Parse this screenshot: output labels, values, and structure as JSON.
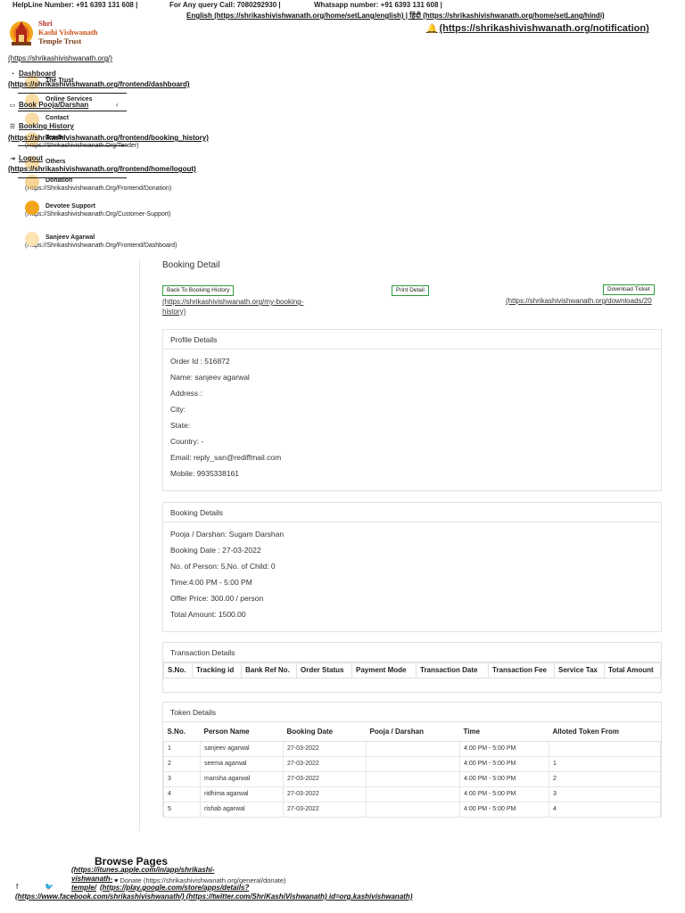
{
  "topbar": {
    "helpline": "HelpLine Number: +91 6393 131 608 |",
    "query": "For Any query Call: 7080292930 |",
    "whatsapp": "Whatsapp number: +91 6393 131 608 |",
    "lang_links": "English (https://shrikashivishwanath.org/home/setLang/english) | हिंदी (https://shrikashivishwanath.org/home/setLang/hindi)",
    "notification": "(https://shrikashivishwanath.org/notification)"
  },
  "logo": {
    "line1": "Shri",
    "line2": "Kashi Vishwanath",
    "line3": "Temple Trust",
    "url": "(https://shrikashivishwanath.org/)"
  },
  "nav": {
    "dashboard": "Dashboard",
    "dashboard_url": "(https://shrikashivishwanath.org/frontend/dashboard)",
    "book_pooja": "Book Pooja/Darshan",
    "booking_history": "Booking History",
    "booking_history_url": "(https://shrikashivishwanath.org/frontend/booking_history)",
    "logout": "Logout",
    "logout_url": "(https://shrikashivishwanath.org/frontend/home/logout)"
  },
  "nav2": {
    "trust": "The Trust",
    "online_services": "Online Services",
    "contact": "Contact",
    "tender": "Tender",
    "tender_url": "(Https://Shrikashivishwanath.Org/Tender)",
    "others": "Others",
    "donation": "Donation",
    "donation_url": "(Https://Shrikashivishwanath.Org/Frontend/Donation)",
    "devotee_support": "Devotee Support",
    "devotee_support_url": "(Https://Shrikashivishwanath.Org/Customer-Support)",
    "user": "Sanjeev Agarwal",
    "user_url": "(Https://Shrikashivishwanath.Org/Frontend/Dashboard)"
  },
  "page": {
    "title": "Booking Detail",
    "back_btn": "Back To Booking History",
    "back_url": "(https://shrikashivishwanath.org/my-booking-history)",
    "print_btn": "Print Detail",
    "download_btn": "Download Ticket",
    "download_url": "(https://shrikashivishwanath.org/downloads/20"
  },
  "profile": {
    "heading": "Profile Details",
    "rows": [
      "Order Id : 516872",
      "Name: sanjeev agarwal",
      "Address :",
      "City:",
      "State:",
      "Country: -",
      "Email: reply_san@rediffmail.com",
      "Mobile: 9935338161"
    ]
  },
  "booking": {
    "heading": "Booking Details",
    "rows": [
      "Pooja / Darshan: Sugam Darshan",
      "Booking Date : 27-03-2022",
      "No. of Person: 5,No. of Child: 0",
      "Time:4:00 PM - 5:00 PM",
      "Offer Price: 300.00 / person",
      "Total Amount: 1500.00"
    ]
  },
  "transaction": {
    "heading": "Transaction Details",
    "columns": [
      "S.No.",
      "Tracking id",
      "Bank Ref No.",
      "Order Status",
      "Payment Mode",
      "Transaction Date",
      "Transaction Fee",
      "Service Tax",
      "Total Amount"
    ]
  },
  "token": {
    "heading": "Token Details",
    "columns": [
      "S.No.",
      "Person Name",
      "Booking Date",
      "Pooja / Darshan",
      "Time",
      "Alloted Token From"
    ],
    "rows": [
      [
        "1",
        "sanjeev agarwal",
        "27-03-2022",
        "",
        "4:00 PM - 5:00 PM",
        ""
      ],
      [
        "2",
        "seema agarwal",
        "27-03-2022",
        "",
        "4:00 PM - 5:00 PM",
        "1"
      ],
      [
        "3",
        "mansha agarwal",
        "27-03-2022",
        "",
        "4:00 PM - 5:00 PM",
        "2"
      ],
      [
        "4",
        "ridhima agarwal",
        "27-03-2022",
        "",
        "4:00 PM - 5:00 PM",
        "3"
      ],
      [
        "5",
        "rishab agarwal",
        "27-03-2022",
        "",
        "4:00 PM - 5:00 PM",
        "4"
      ]
    ]
  },
  "footer": {
    "browse": "Browse Pages",
    "itunes1": "(https://itunes.apple.com/in/app/shrikashi-",
    "itunes2": "vishwanath-",
    "donate": "Donate (https://shrikashivishwanath.org/general/donate)",
    "temple": "temple/",
    "play": "(https://play.google.com/store/apps/details?",
    "bottom": "(https://www.facebook.com/shrikashivishwanath/) (https://twitter.com/ShriKashiVishwanath) id=org.kashivishwanath)"
  },
  "colors": {
    "accent_green": "#2e9b3a",
    "brand_red": "#b2281c",
    "brand_orange": "#d0521a"
  }
}
